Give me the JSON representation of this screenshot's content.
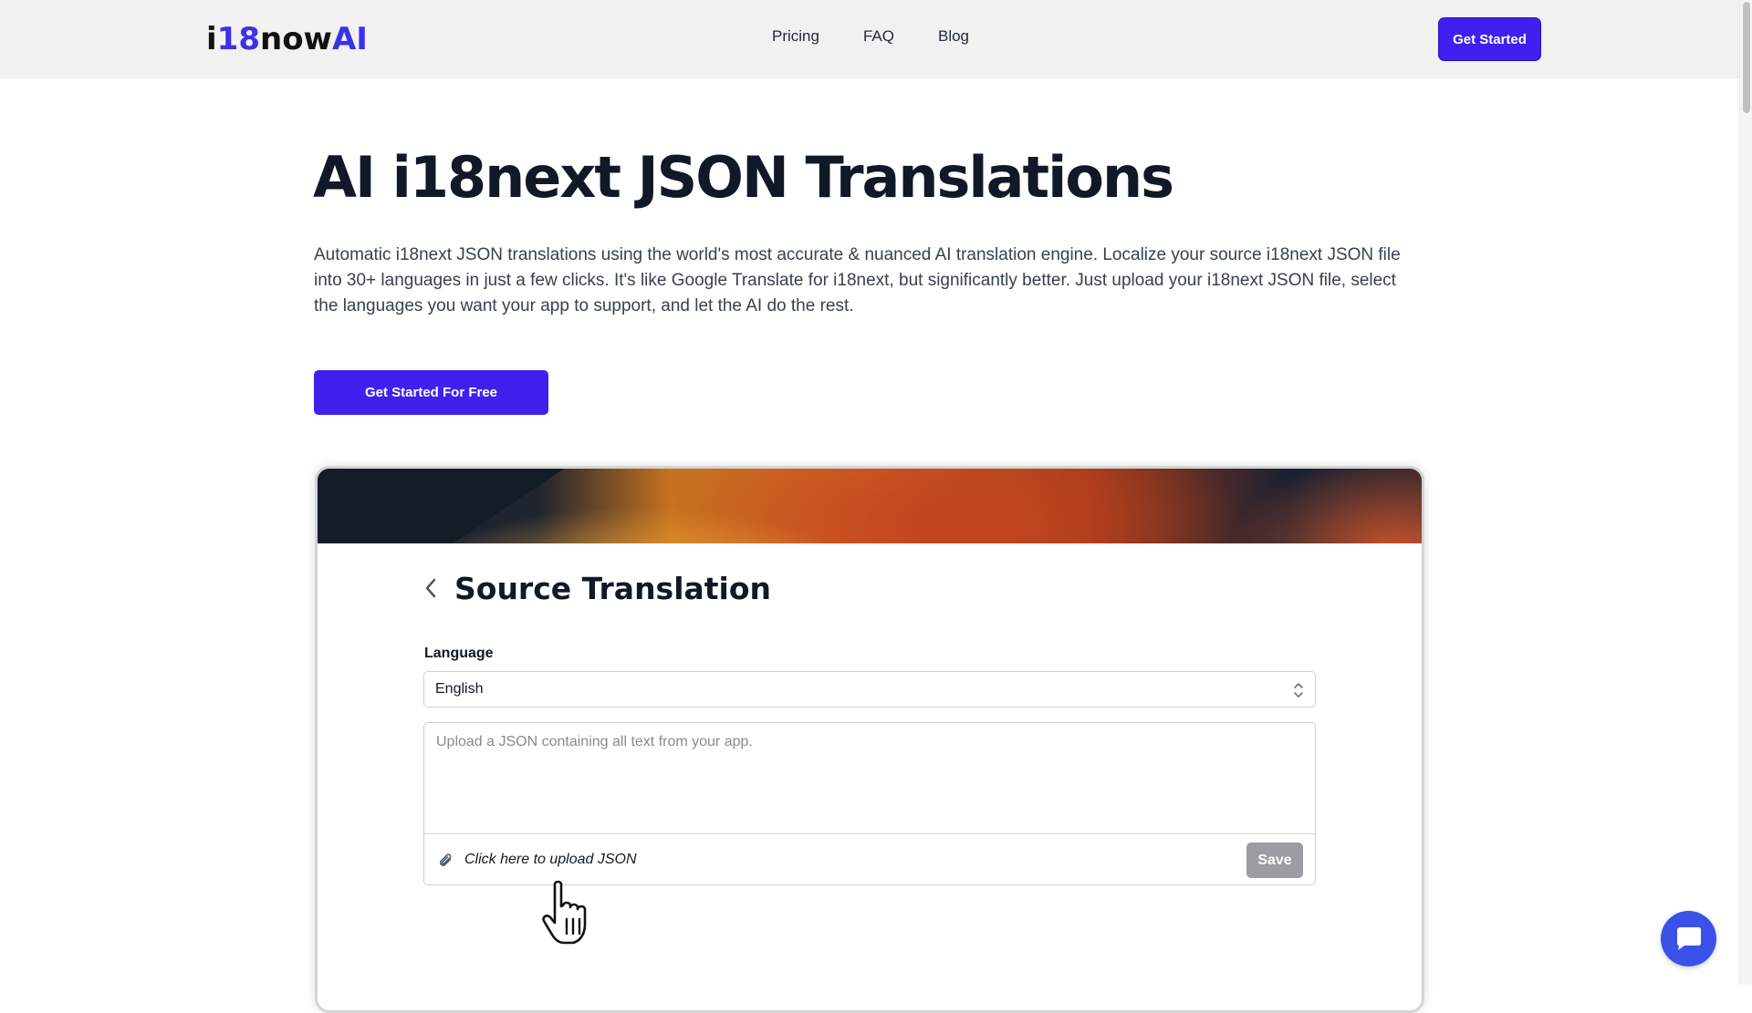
{
  "header": {
    "logo": {
      "part1": "i",
      "part2": "18",
      "part3": "now",
      "part4": "AI"
    },
    "nav": [
      {
        "label": "Pricing"
      },
      {
        "label": "FAQ"
      },
      {
        "label": "Blog"
      }
    ],
    "cta_label": "Get Started"
  },
  "hero": {
    "title": "AI i18next JSON Translations",
    "description": "Automatic i18next JSON translations using the world's most accurate & nuanced AI translation engine. Localize your source i18next JSON file into 30+ languages in just a few clicks. It's like Google Translate for i18next, but significantly better. Just upload your i18next JSON file, select the languages you want your app to support, and let the AI do the rest.",
    "cta_label": "Get Started For Free"
  },
  "demo": {
    "title": "Source Translation",
    "language_label": "Language",
    "language_value": "English",
    "textarea_placeholder": "Upload a JSON containing all text from your app.",
    "upload_label": "Click here to upload JSON",
    "save_label": "Save"
  },
  "icons": {
    "back": "chevron-left-icon",
    "select": "chevron-up-down-icon",
    "attach": "paperclip-icon",
    "pointer": "hand-pointer-icon",
    "chat": "chat-bubble-icon"
  },
  "colors": {
    "brand": "#3f20ee",
    "logo_accent": "#3b32e8",
    "header_bg": "#f1f1f1",
    "save_disabled": "#9b9da2",
    "chat": "#3a52e8"
  }
}
